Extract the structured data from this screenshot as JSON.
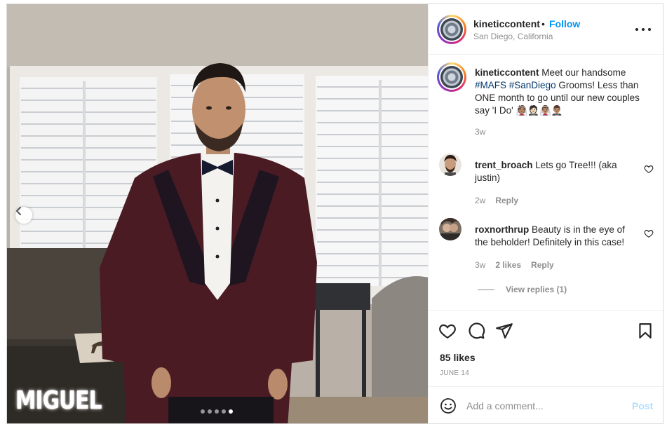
{
  "post": {
    "username": "kineticcontent",
    "separator": "•",
    "follow_label": "Follow",
    "location": "San Diego, California",
    "more_icon": "more-options-icon",
    "overlay_name": "MIGUEL",
    "carousel": {
      "count": 5,
      "active_index": 4
    }
  },
  "caption": {
    "username": "kineticcontent",
    "text_1": " Meet our handsome ",
    "hashtag_1": "#MAFS",
    "text_2": " ",
    "hashtag_2": "#SanDiego",
    "text_3": " Grooms! Less than ONE month to go until our new couples say 'I Do' ",
    "emojis": "👰🏽🤵🏻👰🏽‍♂️🤵🏽‍♂️",
    "time": "3w"
  },
  "comments": [
    {
      "username": "trent_broach",
      "text": " Lets go Tree!!! (aka justin)",
      "time": "2w",
      "reply_label": "Reply"
    },
    {
      "username": "roxnorthrup",
      "text": " Beauty is in the eye of the beholder! Definitely in this case!",
      "time": "3w",
      "likes": "2 likes",
      "reply_label": "Reply",
      "view_replies": "View replies (1)"
    }
  ],
  "actions": {
    "likes": "85 likes",
    "date": "JUNE 14"
  },
  "composer": {
    "placeholder": "Add a comment...",
    "post_label": "Post"
  },
  "colors": {
    "accent": "#0095f6",
    "hashtag": "#00376b",
    "muted": "#8e8e8e",
    "post_disabled": "#b2dffc"
  }
}
